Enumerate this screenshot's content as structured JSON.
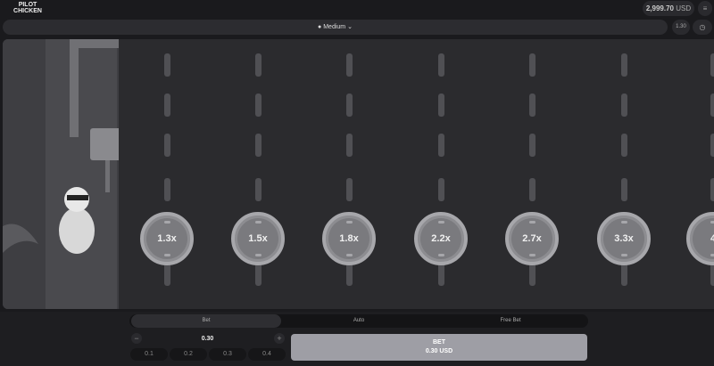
{
  "header": {
    "logo": "PILOT CHICKEN",
    "balance": "2,999.70",
    "currency": "USD",
    "menu_icon": "hamburger-icon"
  },
  "toolbar": {
    "difficulty": "Medium",
    "difficulty_icon": "egg-icon",
    "multiplier": "1.30",
    "history_icon": "clock-icon"
  },
  "game": {
    "multipliers": [
      "1.3x",
      "1.5x",
      "1.8x",
      "2.2x",
      "2.7x",
      "3.3x",
      "4"
    ]
  },
  "bet_panel": {
    "tabs": [
      "Bet",
      "Auto",
      "Free Bet"
    ],
    "active_tab": "Bet",
    "amount": "0.30",
    "quick_amounts": [
      "0.1",
      "0.2",
      "0.3",
      "0.4"
    ],
    "bet_label": "BET",
    "bet_amount": "0.30 USD"
  },
  "colors": {
    "background": "#1a1a1d",
    "game_area": "#2b2b2e",
    "bet_button": "#9e9ea5"
  }
}
